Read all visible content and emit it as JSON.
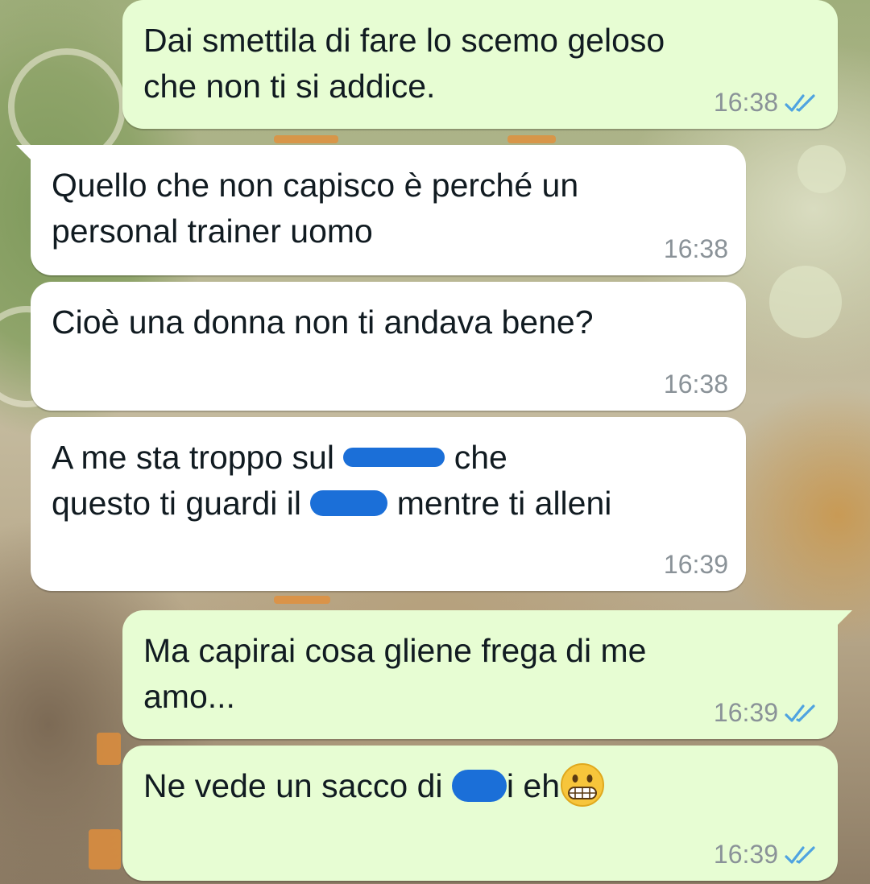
{
  "colors": {
    "outgoing_bubble": "#e7fdd3",
    "incoming_bubble": "#ffffff",
    "read_ticks": "#4fa3e0",
    "timestamp": "#8a9298",
    "redaction": "#1b6fd8"
  },
  "messages": [
    {
      "direction": "outgoing",
      "text": "Dai smettila di fare lo scemo geloso\nche non ti si addice.",
      "time": "16:38",
      "status_icon": "double-check-read-icon"
    },
    {
      "direction": "incoming",
      "text": "Quello che non capisco è perché un\npersonal trainer uomo",
      "time": "16:38"
    },
    {
      "direction": "incoming",
      "text": "Cioè una donna non ti andava bene?",
      "time": "16:38"
    },
    {
      "direction": "incoming",
      "text_line1_before": "A me sta troppo sul ",
      "text_line1_after": " che",
      "text_line2_before": "questo ti guardi il ",
      "text_line2_after": " mentre ti alleni",
      "time": "16:39"
    },
    {
      "direction": "outgoing",
      "text": "Ma capirai cosa gliene frega di me\namo...",
      "time": "16:39",
      "status_icon": "double-check-read-icon"
    },
    {
      "direction": "outgoing",
      "text_before": "Ne vede un sacco di ",
      "text_after": "i eh",
      "emoji": "grimacing-face-emoji",
      "time": "16:39",
      "status_icon": "double-check-read-icon"
    }
  ]
}
